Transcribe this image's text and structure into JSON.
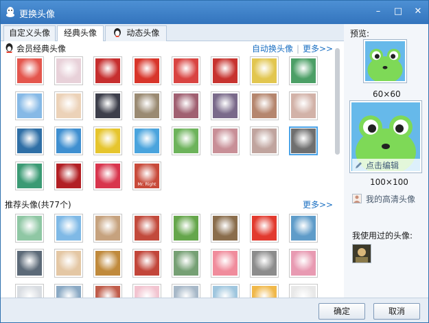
{
  "window": {
    "title": "更换头像",
    "minimize": "–",
    "maximize": "□",
    "close": "✕"
  },
  "tabs": [
    {
      "label": "自定义头像"
    },
    {
      "label": "经典头像"
    },
    {
      "label": "动态头像"
    }
  ],
  "classic": {
    "header": "会员经典头像",
    "auto_change": "自动换头像",
    "separator": "|",
    "more": "更多>>",
    "avatars": [
      "#e4564d",
      "#e8d1d9",
      "#c62e2e",
      "#d8352a",
      "#d94441",
      "#c7332f",
      "#e2c64f",
      "#4c9f66",
      "#86b9e6",
      "#ecd2b8",
      "#3d3f4b",
      "#9a8a72",
      "#a06071",
      "#7a6a8a",
      "#b5866e",
      "#d2b2a8",
      "#2f6fa6",
      "#3f8fd0",
      "#e6c52d",
      "#4aa4dd",
      "#6db35b",
      "#c88f97",
      "#c0a49e",
      "#6f6f6f",
      "#3b9a74",
      "#b21f24",
      "#d8354d",
      "#c84a3a"
    ],
    "avatar_text": {
      "27": "Mr. Right"
    }
  },
  "recommended": {
    "header": "推荐头像(共77个)",
    "more": "更多>>",
    "avatars": [
      "#8fc7a4",
      "#7fb9e6",
      "#c6a27e",
      "#c24a3c",
      "#65a64b",
      "#8a6d4c",
      "#e23a2e",
      "#5f9cc9",
      "#5c6a78",
      "#e4c7a4",
      "#c08a3c",
      "#c2463a",
      "#76a074",
      "#f08c9c",
      "#8c8c8c",
      "#e89ab2",
      "#d9dde2",
      "#8aa9c4",
      "#c05c4a",
      "#f2c4d0",
      "#a7b8c8",
      "#9fc6de",
      "#f0b84a",
      "#e8e8e8"
    ]
  },
  "preview": {
    "label": "预览:",
    "size_small": "60×60",
    "size_large": "100×100",
    "edit": "点击编辑",
    "hd_avatar": "我的高清头像",
    "used_label": "我使用过的头像:"
  },
  "buttons": {
    "ok": "确定",
    "cancel": "取消"
  },
  "colors": {
    "titlebar": "#3a7dc6",
    "link": "#1a6fc2",
    "frog": "#7ed957",
    "frog_bg": "#66b9ea"
  }
}
